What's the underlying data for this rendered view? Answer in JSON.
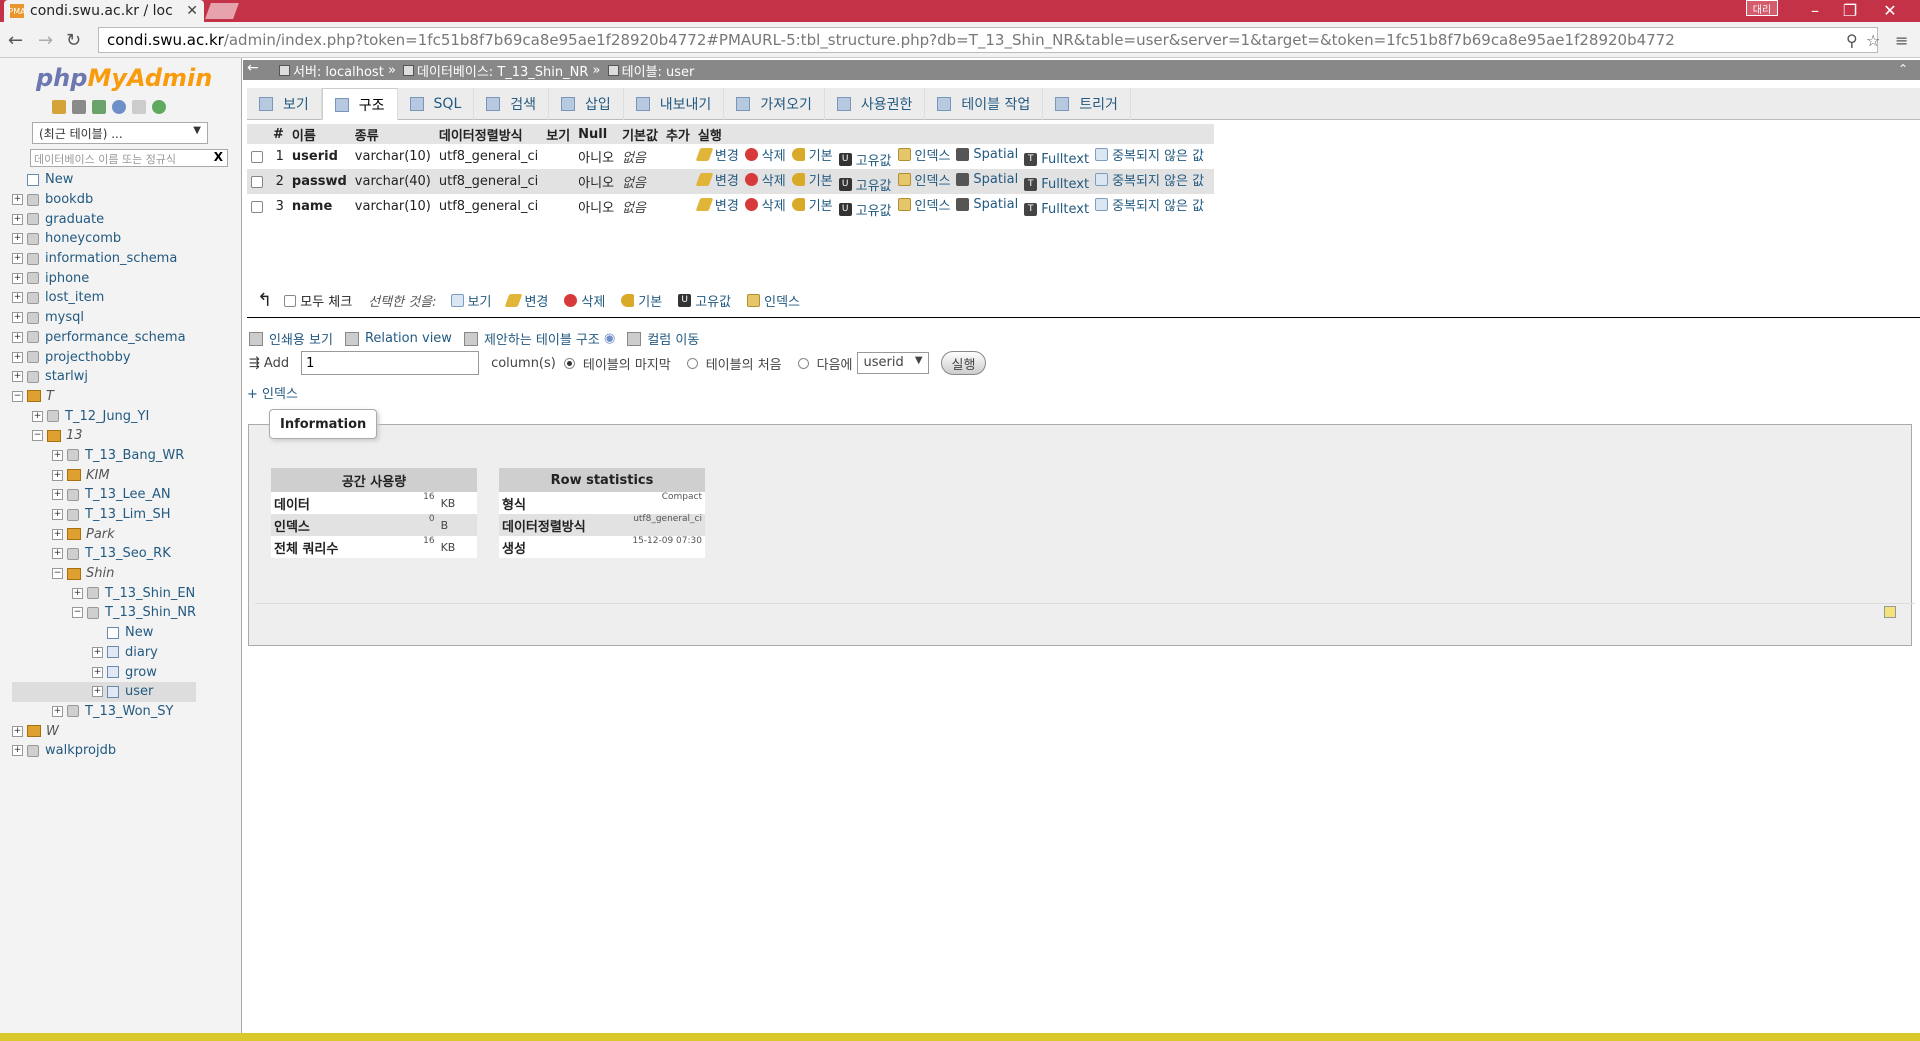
{
  "browser": {
    "tab_title": "condi.swu.ac.kr / loc",
    "user_badge": "대리",
    "url_host": "condi.swu.ac.kr",
    "url_path": "/admin/index.php?token=1fc51b8f7b69ca8e95ae1f28920b4772#PMAURL-5:tbl_structure.php?db=T_13_Shin_NR&table=user&server=1&target=&token=1fc51b8f7b69ca8e95ae1f28920b4772"
  },
  "sidebar": {
    "logo_php": "php",
    "logo_myadmin": "MyAdmin",
    "recent_select": "(최근 테이블) ...",
    "filter_placeholder": "데이터베이스 이름 또는 정규식",
    "filter_clear": "X",
    "tree": [
      {
        "label": "New",
        "type": "new",
        "depth": 0
      },
      {
        "label": "bookdb",
        "type": "db",
        "depth": 0
      },
      {
        "label": "graduate",
        "type": "db",
        "depth": 0
      },
      {
        "label": "honeycomb",
        "type": "db",
        "depth": 0
      },
      {
        "label": "information_schema",
        "type": "db",
        "depth": 0
      },
      {
        "label": "iphone",
        "type": "db",
        "depth": 0
      },
      {
        "label": "lost_item",
        "type": "db",
        "depth": 0
      },
      {
        "label": "mysql",
        "type": "db",
        "depth": 0
      },
      {
        "label": "performance_schema",
        "type": "db",
        "depth": 0
      },
      {
        "label": "projecthobby",
        "type": "db",
        "depth": 0
      },
      {
        "label": "starlwj",
        "type": "db",
        "depth": 0
      },
      {
        "label": "T",
        "type": "group",
        "depth": 0,
        "open": true
      },
      {
        "label": "T_12_Jung_YI",
        "type": "db",
        "depth": 1
      },
      {
        "label": "13",
        "type": "group",
        "depth": 1,
        "open": true
      },
      {
        "label": "T_13_Bang_WR",
        "type": "db",
        "depth": 2
      },
      {
        "label": "KIM",
        "type": "group",
        "depth": 2
      },
      {
        "label": "T_13_Lee_AN",
        "type": "db",
        "depth": 2
      },
      {
        "label": "T_13_Lim_SH",
        "type": "db",
        "depth": 2
      },
      {
        "label": "Park",
        "type": "group",
        "depth": 2
      },
      {
        "label": "T_13_Seo_RK",
        "type": "db",
        "depth": 2
      },
      {
        "label": "Shin",
        "type": "group",
        "depth": 2,
        "open": true
      },
      {
        "label": "T_13_Shin_EN",
        "type": "db",
        "depth": 3
      },
      {
        "label": "T_13_Shin_NR",
        "type": "db",
        "depth": 3,
        "open": true
      },
      {
        "label": "New",
        "type": "new",
        "depth": 4
      },
      {
        "label": "diary",
        "type": "table",
        "depth": 4
      },
      {
        "label": "grow",
        "type": "table",
        "depth": 4
      },
      {
        "label": "user",
        "type": "table",
        "depth": 4,
        "selected": true
      },
      {
        "label": "T_13_Won_SY",
        "type": "db",
        "depth": 2
      },
      {
        "label": "W",
        "type": "group",
        "depth": 0
      },
      {
        "label": "walkprojdb",
        "type": "db",
        "depth": 0
      }
    ]
  },
  "breadcrumb": {
    "server_label": "서버: localhost",
    "db_label": "데이터베이스: T_13_Shin_NR",
    "table_label": "테이블: user",
    "sep": "»"
  },
  "menu": [
    {
      "label": "보기",
      "active": false
    },
    {
      "label": "구조",
      "active": true
    },
    {
      "label": "SQL",
      "active": false
    },
    {
      "label": "검색",
      "active": false
    },
    {
      "label": "삽입",
      "active": false
    },
    {
      "label": "내보내기",
      "active": false
    },
    {
      "label": "가져오기",
      "active": false
    },
    {
      "label": "사용권한",
      "active": false
    },
    {
      "label": "테이블 작업",
      "active": false
    },
    {
      "label": "트리거",
      "active": false
    }
  ],
  "structure": {
    "headers": [
      "#",
      "이름",
      "종류",
      "데이터정렬방식",
      "보기",
      "Null",
      "기본값",
      "추가",
      "실행"
    ],
    "rows": [
      {
        "num": "1",
        "name": "userid",
        "type": "varchar(10)",
        "collation": "utf8_general_ci",
        "null": "아니오",
        "default": "없음"
      },
      {
        "num": "2",
        "name": "passwd",
        "type": "varchar(40)",
        "collation": "utf8_general_ci",
        "null": "아니오",
        "default": "없음"
      },
      {
        "num": "3",
        "name": "name",
        "type": "varchar(10)",
        "collation": "utf8_general_ci",
        "null": "아니오",
        "default": "없음"
      }
    ],
    "actions": {
      "change": "변경",
      "drop": "삭제",
      "primary": "기본",
      "unique": "고유값",
      "index": "인덱스",
      "spatial": "Spatial",
      "fulltext": "Fulltext",
      "distinct": "중복되지 않은 값"
    }
  },
  "selection": {
    "check_all": "모두 체크",
    "with_selected": "선택한 것을:",
    "browse": "보기",
    "change": "변경",
    "drop": "삭제",
    "primary": "기본",
    "unique": "고유값",
    "index": "인덱스"
  },
  "links": {
    "print": "인쇄용 보기",
    "relation": "Relation view",
    "propose": "제안하는 테이블 구조",
    "move": "컬럼 이동"
  },
  "add_columns": {
    "label": "Add",
    "value": "1",
    "columns_label": "column(s)",
    "at_end": "테이블의 마지막",
    "at_start": "테이블의 처음",
    "after": "다음에",
    "after_select": "userid",
    "go": "실행"
  },
  "index_link": "+ 인덱스",
  "information": {
    "legend": "Information",
    "space": {
      "header": "공간 사용량",
      "rows": [
        {
          "label": "데이터",
          "value": "16",
          "unit": "KB"
        },
        {
          "label": "인덱스",
          "value": "0",
          "unit": "B"
        },
        {
          "label": "전체 쿼리수",
          "value": "16",
          "unit": "KB"
        }
      ]
    },
    "rowstats": {
      "header": "Row statistics",
      "rows": [
        {
          "label": "형식",
          "value": "Compact"
        },
        {
          "label": "데이터정렬방식",
          "value": "utf8_general_ci"
        },
        {
          "label": "생성",
          "value": "15-12-09 07:30"
        }
      ]
    }
  }
}
